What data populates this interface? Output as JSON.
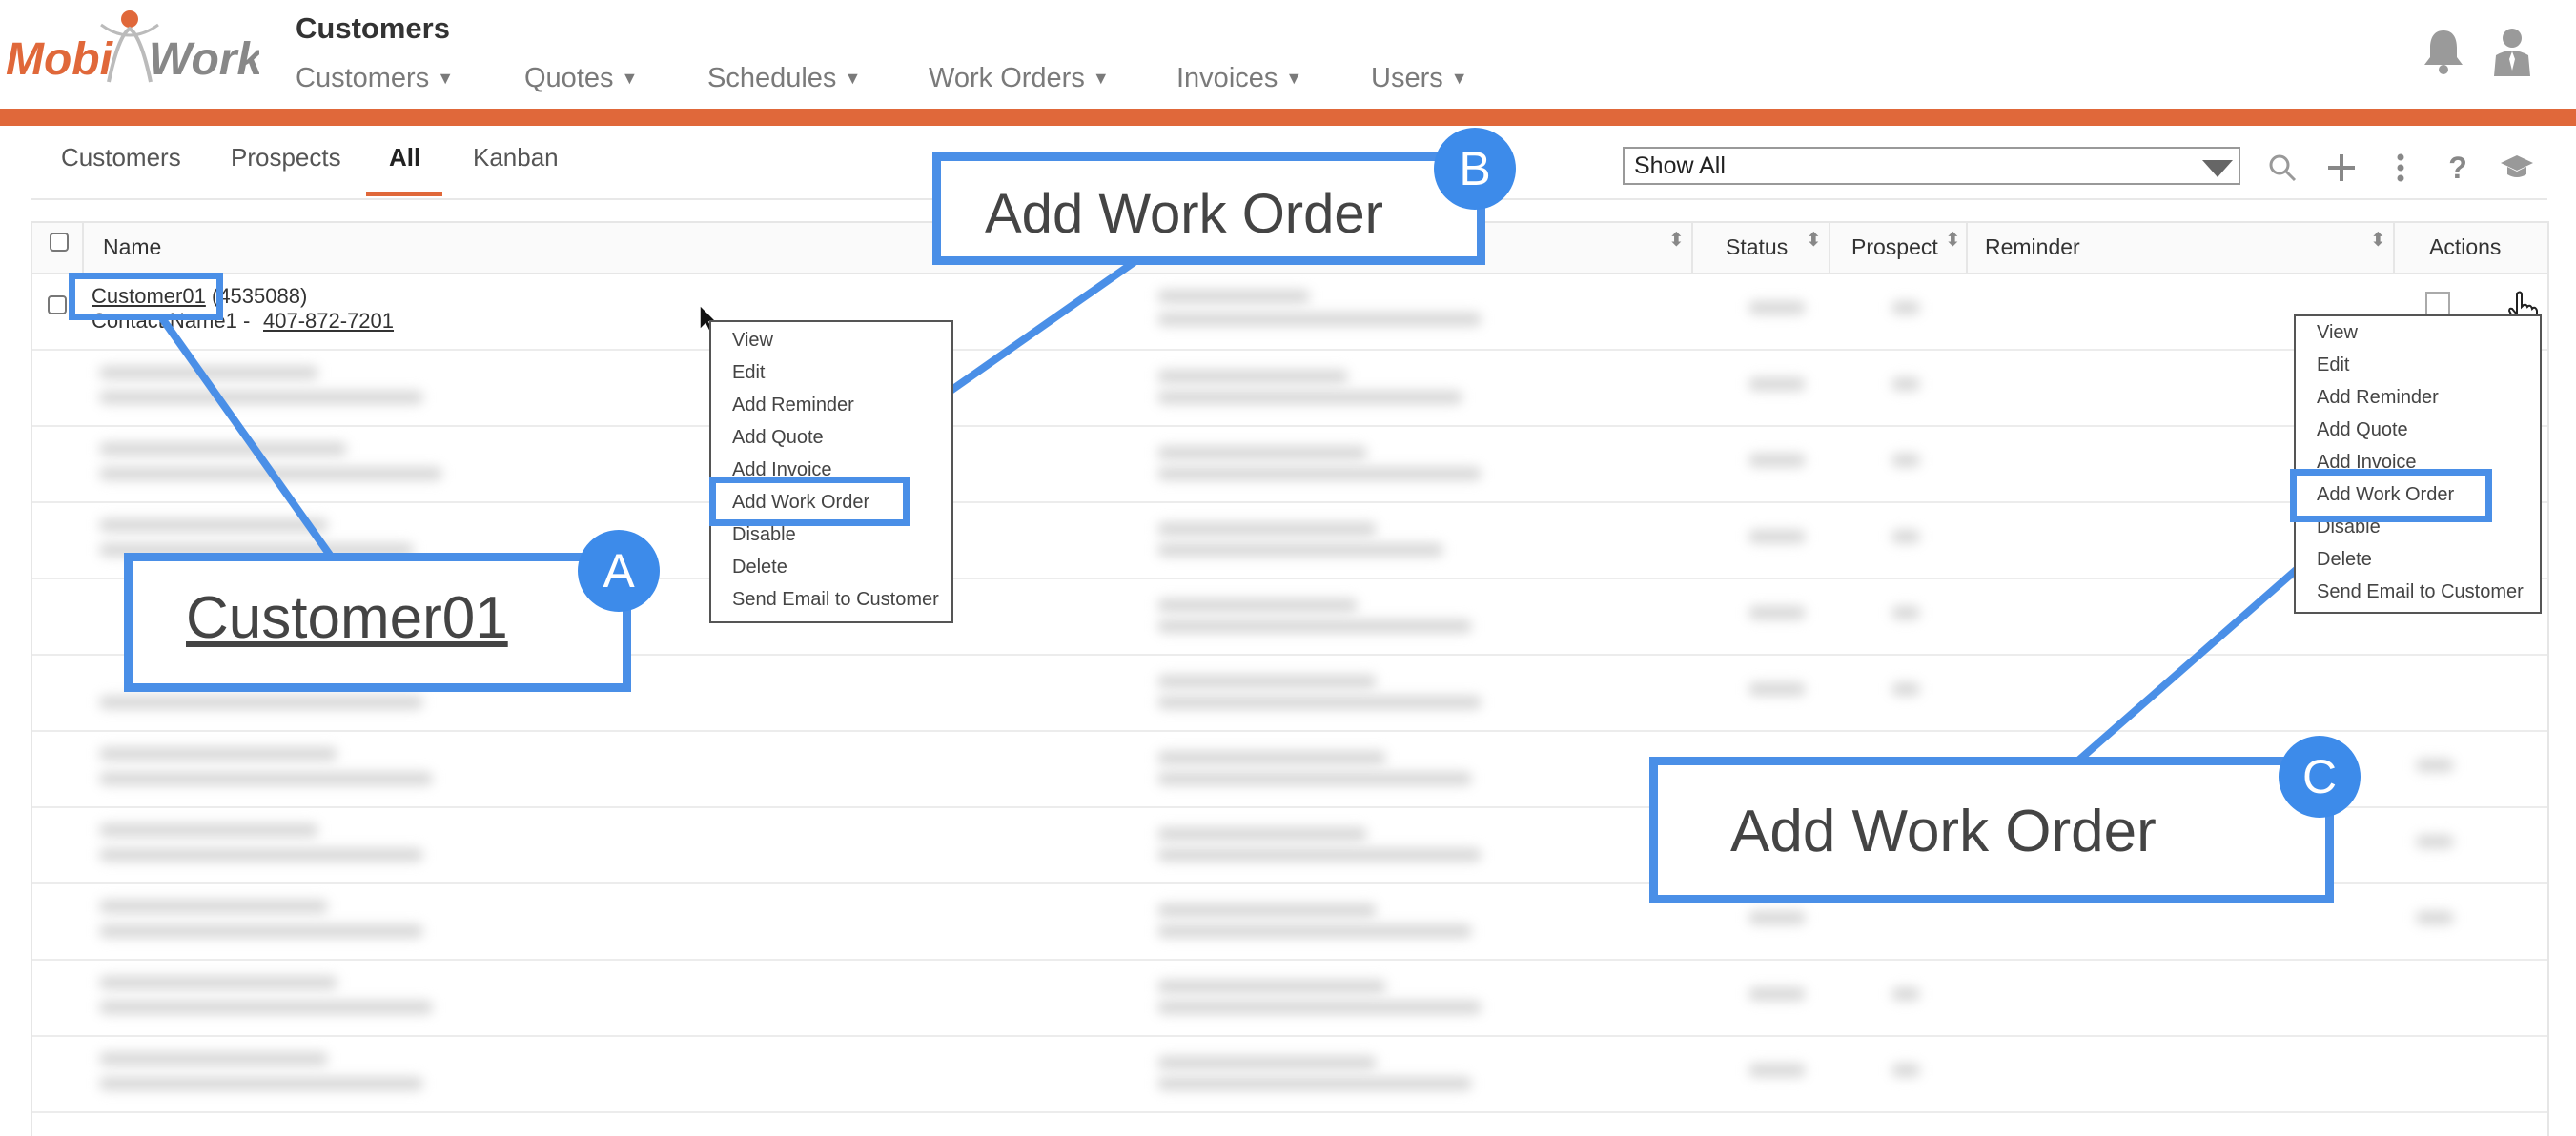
{
  "app": {
    "brand": "MobiWork",
    "brand_part1": "Mobi",
    "brand_part2": "Work",
    "page_title": "Customers"
  },
  "nav": [
    {
      "label": "Customers"
    },
    {
      "label": "Quotes"
    },
    {
      "label": "Schedules"
    },
    {
      "label": "Work Orders"
    },
    {
      "label": "Invoices"
    },
    {
      "label": "Users"
    }
  ],
  "subtabs": [
    {
      "label": "Customers"
    },
    {
      "label": "Prospects"
    },
    {
      "label": "All"
    },
    {
      "label": "Kanban"
    }
  ],
  "filter": {
    "selected": "Show All"
  },
  "table": {
    "headers": {
      "name": "Name",
      "status": "Status",
      "prospect": "Prospect",
      "reminder": "Reminder",
      "actions": "Actions"
    },
    "first_row": {
      "customer": "Customer01",
      "id": "(4535088)",
      "contact": "Contact Name1 - ",
      "phone": "407-872-7201"
    }
  },
  "context_menu": {
    "items": [
      "View",
      "Edit",
      "Add Reminder",
      "Add Quote",
      "Add Invoice",
      "Add Work Order",
      "Disable",
      "Delete",
      "Send Email to Customer"
    ]
  },
  "callouts": {
    "a": {
      "badge": "A",
      "text": "Customer01"
    },
    "b": {
      "badge": "B",
      "text": "Add Work Order"
    },
    "c": {
      "badge": "C",
      "text": "Add Work Order"
    }
  },
  "colors": {
    "accent": "#e0683a",
    "highlight": "#4a8fe7"
  }
}
